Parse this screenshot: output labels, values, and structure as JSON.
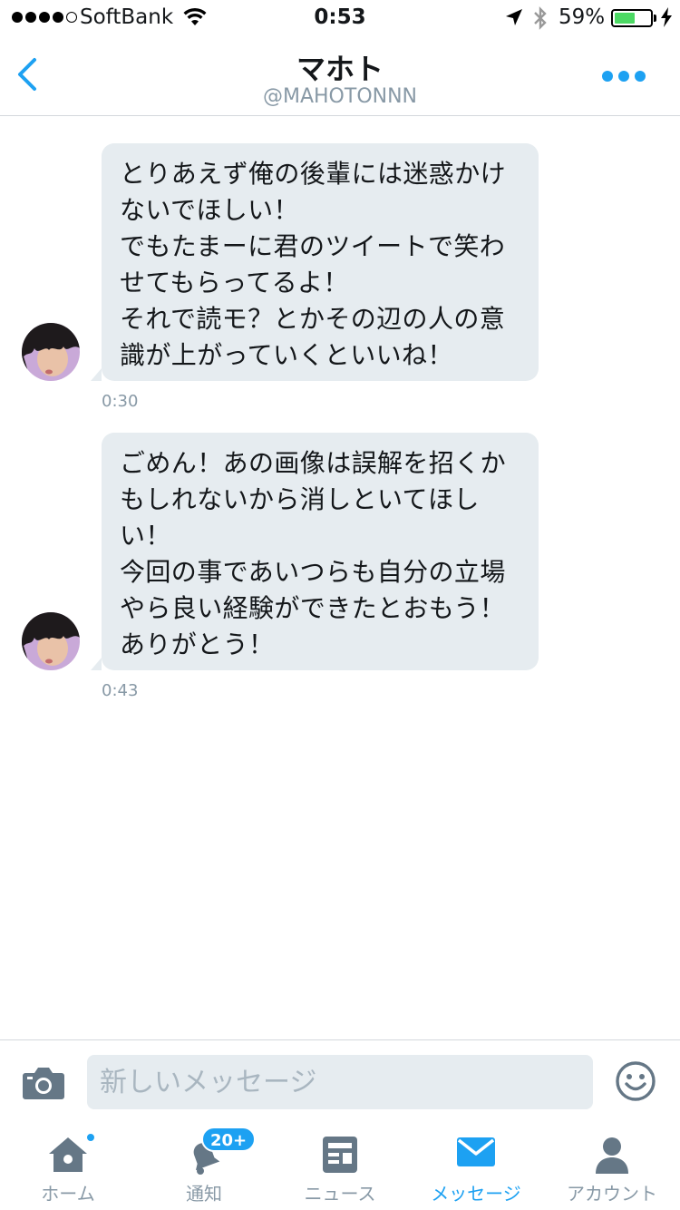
{
  "status_bar": {
    "carrier": "SoftBank",
    "time": "0:53",
    "battery_percent": "59%",
    "battery_level": 0.59,
    "signal_bars_filled": 4,
    "signal_bars_total": 5
  },
  "header": {
    "name": "マホト",
    "handle": "@MAHOTONNN",
    "accent_color": "#1da1f2"
  },
  "messages": [
    {
      "paragraphs": [
        "とりあえず俺の後輩には迷惑かけないでほしい！",
        "でもたまーに君のツイートで笑わせてもらってるよ！",
        "それで読モ？とかその辺の人の意識が上がっていくといいね！"
      ],
      "time": "0:30"
    },
    {
      "paragraphs": [
        "ごめん！あの画像は誤解を招くかもしれないから消しといてほしい！",
        "今回の事であいつらも自分の立場やら良い経験ができたとおもう！ありがとう！"
      ],
      "time": "0:43"
    }
  ],
  "compose": {
    "placeholder": "新しいメッセージ"
  },
  "tabs": [
    {
      "label": "ホーム",
      "icon": "home-icon",
      "badge": ""
    },
    {
      "label": "通知",
      "icon": "bell-icon",
      "badge": "20+"
    },
    {
      "label": "ニュース",
      "icon": "news-icon",
      "badge": ""
    },
    {
      "label": "メッセージ",
      "icon": "envelope-icon",
      "badge": ""
    },
    {
      "label": "アカウント",
      "icon": "person-icon",
      "badge": ""
    }
  ],
  "colors": {
    "accent": "#1da1f2",
    "bubble": "#e6ecf0",
    "muted": "#8899a6"
  }
}
